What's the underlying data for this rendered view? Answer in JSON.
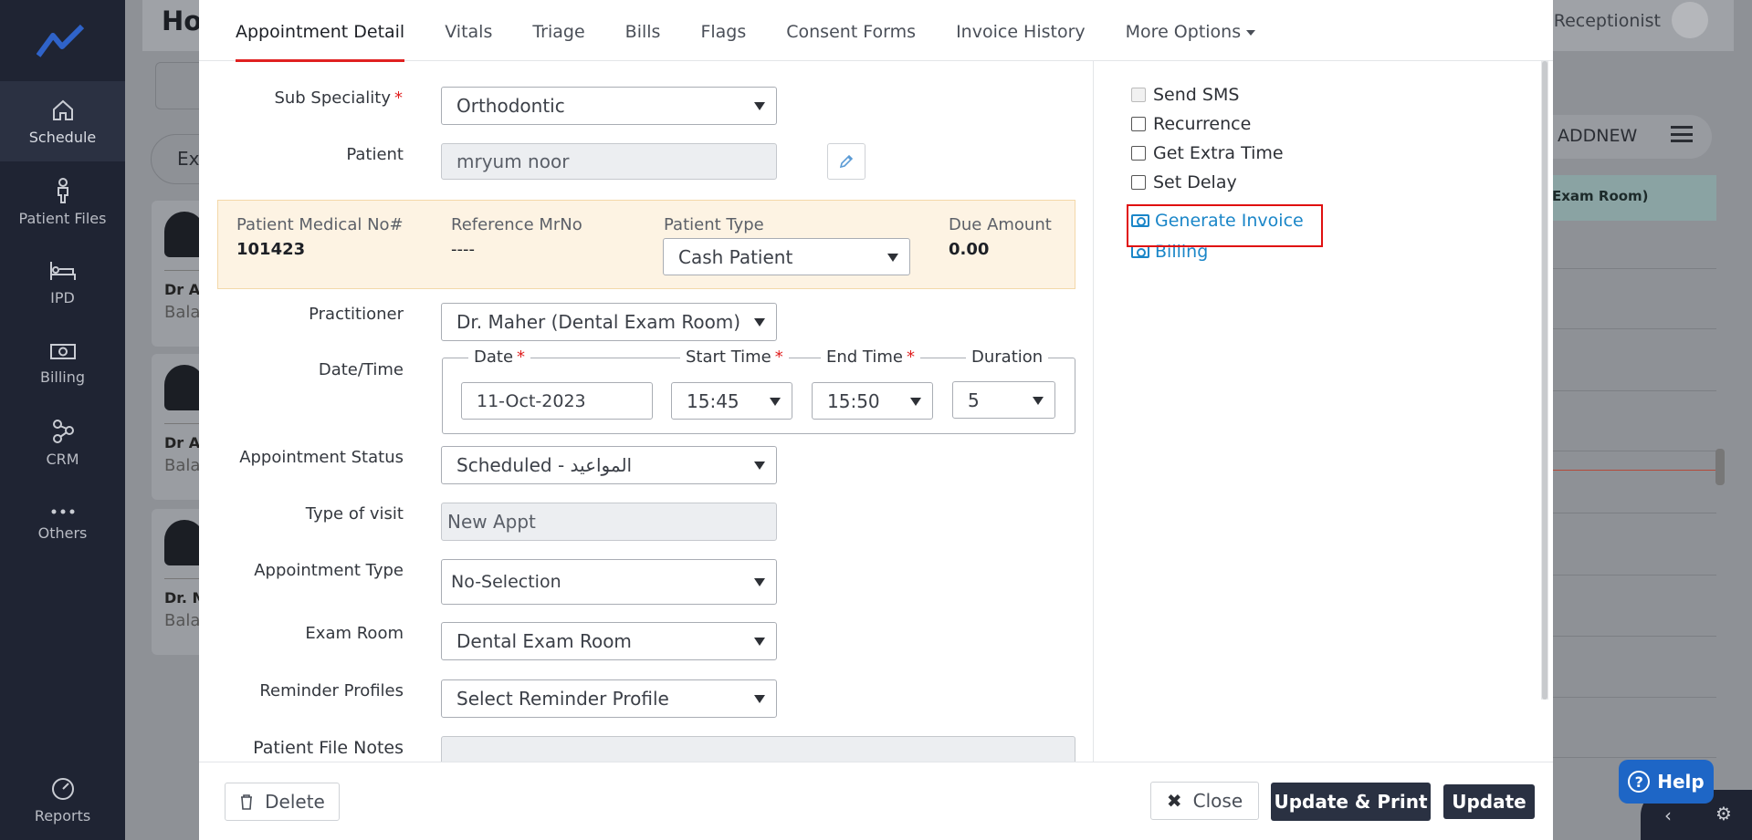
{
  "sidebar": {
    "items": [
      {
        "label": "Schedule",
        "icon": "home-icon"
      },
      {
        "label": "Patient Files",
        "icon": "person-icon"
      },
      {
        "label": "IPD",
        "icon": "bed-icon"
      },
      {
        "label": "Billing",
        "icon": "money-icon"
      },
      {
        "label": "CRM",
        "icon": "network-icon"
      },
      {
        "label": "Others",
        "icon": "dots-icon"
      }
    ],
    "bottom_label": "Reports"
  },
  "background": {
    "title": "Ho",
    "role": "Receptionist",
    "filter_chip": "Ex",
    "addnew": "ADDNEW",
    "column_header": "Exam Room)",
    "cards": [
      {
        "name": "Dr A",
        "sub": "Bala"
      },
      {
        "name": "Dr A",
        "sub": "Bala"
      },
      {
        "name": "Dr. M",
        "sub": "Bala"
      }
    ]
  },
  "tabs": [
    {
      "label": "Appointment Detail",
      "active": true
    },
    {
      "label": "Vitals"
    },
    {
      "label": "Triage"
    },
    {
      "label": "Bills"
    },
    {
      "label": "Flags"
    },
    {
      "label": "Consent Forms"
    },
    {
      "label": "Invoice History"
    },
    {
      "label": "More Options"
    }
  ],
  "form": {
    "sub_speciality": {
      "label": "Sub Speciality",
      "value": "Orthodontic"
    },
    "patient": {
      "label": "Patient",
      "value": "mryum  noor"
    },
    "info": {
      "medical_no_label": "Patient Medical No#",
      "medical_no": "101423",
      "ref_mrno_label": "Reference MrNo",
      "ref_mrno": "----",
      "patient_type_label": "Patient Type",
      "patient_type": "Cash Patient",
      "due_label": "Due Amount",
      "due": "0.00"
    },
    "practitioner": {
      "label": "Practitioner",
      "value": "Dr. Maher (Dental Exam Room)"
    },
    "datetime": {
      "label": "Date/Time",
      "date_label": "Date",
      "date": "11-Oct-2023",
      "start_label": "Start Time",
      "start": "15:45",
      "end_label": "End Time",
      "end": "15:50",
      "duration_label": "Duration",
      "duration": "5"
    },
    "status": {
      "label": "Appointment Status",
      "value": "Scheduled - المواعيد"
    },
    "visit_type": {
      "label": "Type of visit",
      "value": "New Appt"
    },
    "appt_type": {
      "label": "Appointment Type",
      "value": "No-Selection"
    },
    "exam_room": {
      "label": "Exam Room",
      "value": "Dental Exam Room"
    },
    "reminder": {
      "label": "Reminder Profiles",
      "value": "Select Reminder Profile"
    },
    "notes": {
      "label": "Patient File Notes"
    }
  },
  "options": {
    "send_sms": "Send SMS",
    "recurrence": "Recurrence",
    "extra_time": "Get Extra Time",
    "set_delay": "Set Delay",
    "generate_invoice": "Generate Invoice",
    "billing": "Billing"
  },
  "footer": {
    "delete": "Delete",
    "close": "Close",
    "update_print": "Update & Print",
    "update": "Update"
  },
  "help": "Help",
  "colors": {
    "accent_red": "#e02020",
    "link_blue": "#1a86c8",
    "dark_button": "#2a3142",
    "sidebar": "#1f2433"
  }
}
